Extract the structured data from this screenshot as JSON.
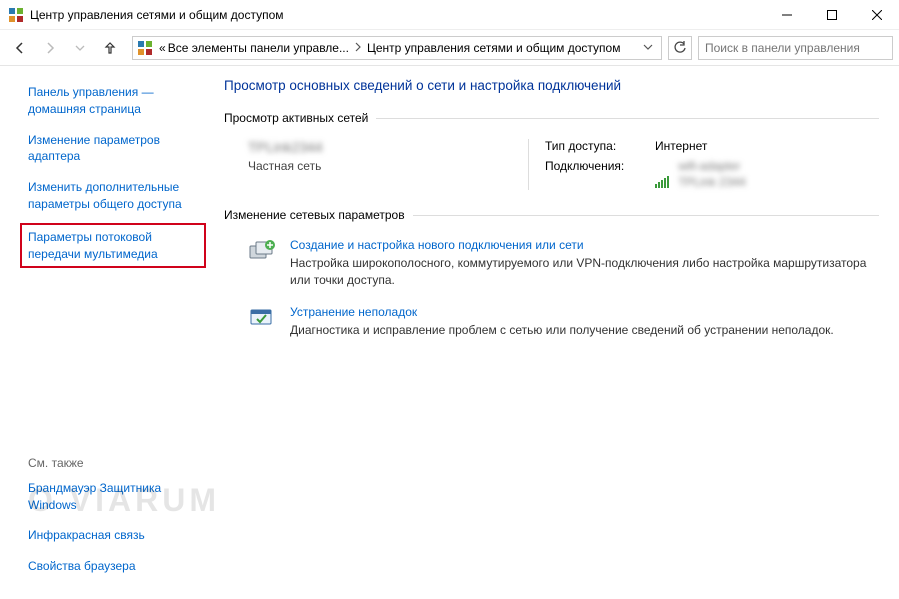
{
  "window": {
    "title": "Центр управления сетями и общим доступом"
  },
  "breadcrumb": {
    "root_prefix": "«",
    "parent": "Все элементы панели управле...",
    "current": "Центр управления сетями и общим доступом"
  },
  "search": {
    "placeholder": "Поиск в панели управления"
  },
  "sidebar": {
    "links": [
      "Панель управления — домашняя страница",
      "Изменение параметров адаптера",
      "Изменить дополнительные параметры общего доступа",
      "Параметры потоковой передачи мультимедиа"
    ],
    "see_also_label": "См. также",
    "see_also": [
      "Брандмауэр Защитника Windows",
      "Инфракрасная связь",
      "Свойства браузера"
    ]
  },
  "main": {
    "heading": "Просмотр основных сведений о сети и настройка подключений",
    "active_networks_label": "Просмотр активных сетей",
    "network": {
      "name_blurred": "TPLink2344",
      "type": "Частная сеть",
      "access_label": "Тип доступа:",
      "access_value": "Интернет",
      "connections_label": "Подключения:",
      "connection_blurred_line1": "wifi-adapter",
      "connection_blurred_line2": "TPLink 2344"
    },
    "change_settings_label": "Изменение сетевых параметров",
    "tasks": [
      {
        "title": "Создание и настройка нового подключения или сети",
        "desc": "Настройка широкополосного, коммутируемого или VPN-подключения либо настройка маршрутизатора или точки доступа."
      },
      {
        "title": "Устранение неполадок",
        "desc": "Диагностика и исправление проблем с сетью или получение сведений об устранении неполадок."
      }
    ]
  },
  "watermark": "O VIARUM"
}
